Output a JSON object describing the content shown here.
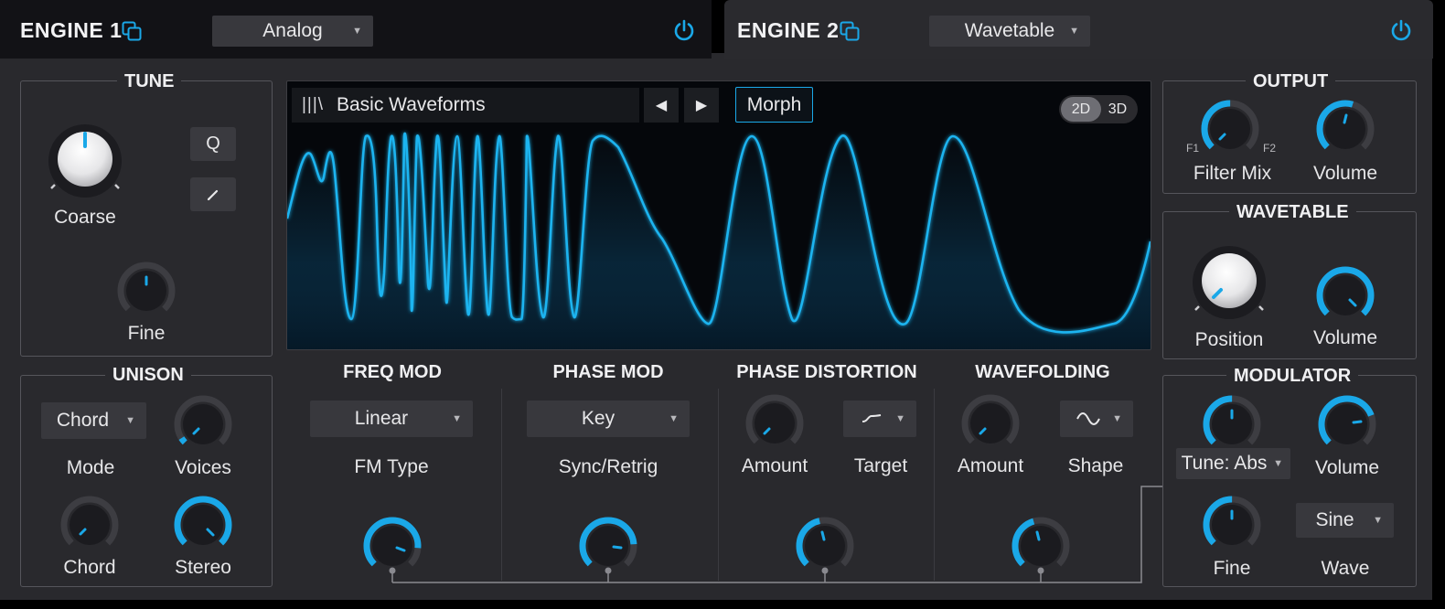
{
  "engine1": {
    "title": "ENGINE 1",
    "type_value": "Analog"
  },
  "engine2": {
    "title": "ENGINE 2",
    "type_value": "Wavetable"
  },
  "tune": {
    "title": "TUNE",
    "coarse_label": "Coarse",
    "fine_label": "Fine",
    "q_label": "Q"
  },
  "unison": {
    "title": "UNISON",
    "mode_value": "Chord",
    "mode_label": "Mode",
    "voices_label": "Voices",
    "chord_label": "Chord",
    "stereo_label": "Stereo"
  },
  "display": {
    "wavetable_name": "Basic Waveforms",
    "morph_label": "Morph",
    "mode_2d": "2D",
    "mode_3d": "3D"
  },
  "freqmod": {
    "title": "FREQ MOD",
    "type_value": "Linear",
    "type_label": "FM Type"
  },
  "phasemod": {
    "title": "PHASE MOD",
    "sync_value": "Key",
    "sync_label": "Sync/Retrig"
  },
  "phasedist": {
    "title": "PHASE DISTORTION",
    "amount_label": "Amount",
    "target_label": "Target"
  },
  "wavefolding": {
    "title": "WAVEFOLDING",
    "amount_label": "Amount",
    "shape_label": "Shape"
  },
  "output": {
    "title": "OUTPUT",
    "filtermix_label": "Filter Mix",
    "f1_label": "F1",
    "f2_label": "F2",
    "volume_label": "Volume"
  },
  "wavetable": {
    "title": "WAVETABLE",
    "position_label": "Position",
    "volume_label": "Volume"
  },
  "modulator": {
    "title": "MODULATOR",
    "tune_value": "Tune: Abs",
    "volume_label": "Volume",
    "fine_label": "Fine",
    "wave_value": "Sine",
    "wave_label": "Wave"
  },
  "colors": {
    "accent": "#1aa8e8",
    "panel_bg": "#29292d",
    "knob_track": "#3d3d42"
  }
}
